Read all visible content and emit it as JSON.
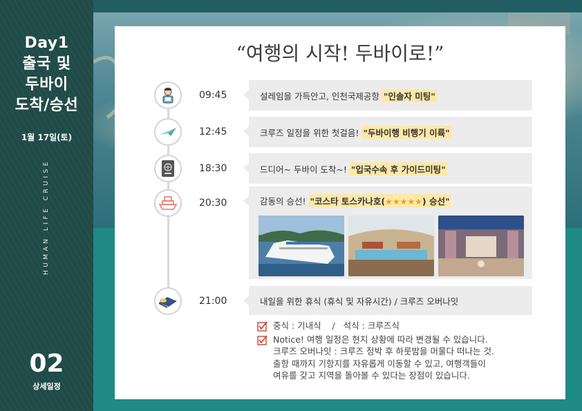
{
  "sidebar": {
    "day_line1": "Day1",
    "day_line2": "출국 및",
    "day_line3": "두바이",
    "day_line4": "도착/승선",
    "date": "1월 17일(토)",
    "vertical": "HUMAN LIFE CRUISE",
    "section_num": "02",
    "section_label": "상세일정"
  },
  "card": {
    "title": "“여행의 시작! 두바이로!”"
  },
  "timeline": [
    {
      "time": "09:45",
      "text": "설레임을 가득안고, 인천국제공항",
      "highlight": "\"인솔자 미팅\"",
      "icon": "person-icon"
    },
    {
      "time": "12:45",
      "text": "크루즈 일정을 위한 첫걸음!",
      "highlight": "\"두바이행 비행기 이륙\"",
      "icon": "airplane-icon"
    },
    {
      "time": "18:30",
      "text": "드디어~ 두바이 도착~!",
      "highlight": "\"입국수속 후 가이드미팅\"",
      "icon": "passport-icon"
    },
    {
      "time": "20:30",
      "text": "감동의 승선!",
      "highlight_pre": "\"코스타 토스카나호(",
      "stars": "★★★★★",
      "highlight_post": ") 승선\"",
      "icon": "ship-icon"
    },
    {
      "time": "21:00",
      "text": "내일을 위한 휴식 (휴식 및 자유시간) / 크루즈 오버나잇",
      "icon": "bed-icon"
    }
  ],
  "notes": [
    {
      "lines": [
        "중식 : 기내식    /   석식 : 크루즈식"
      ]
    },
    {
      "lines": [
        "Notice!  여행 일정은 현지 상황에 따라 변경될 수 있습니다.",
        "크루즈 오버나잇 : 크루즈 정박 후 하룻밤을 머물다 떠나는 것.",
        "출항 때까지 기항지를 자유롭게 이동할 수 있고, 여행객들이",
        "여유를 갖고 지역을 돌아볼 수 있다는 장점이 있습니다."
      ]
    }
  ],
  "colors": {
    "sidebar": "#204b48",
    "teal": "#1f8a86",
    "highlight": "#fde8a9",
    "check": "#c0392b"
  }
}
